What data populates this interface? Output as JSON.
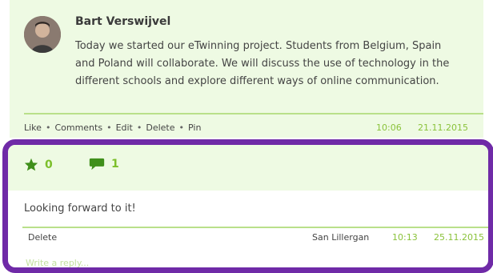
{
  "post": {
    "author": "Bart Verswijvel",
    "text": "Today we started our eTwinning project. Students from Belgium, Spain and Poland will collaborate. We will discuss the use of technology in the different schools and explore different ways of online communication.",
    "actions": [
      "Like",
      "Comments",
      "Edit",
      "Delete",
      "Pin"
    ],
    "time": "10:06",
    "date": "21.11.2015"
  },
  "stats": {
    "likes": "0",
    "comments": "1"
  },
  "comment": {
    "text": "Looking forward to it!",
    "delete_label": "Delete",
    "author": "San Lillergan",
    "time": "10:13",
    "date": "25.11.2015"
  },
  "reply": {
    "placeholder": "Write a reply..."
  },
  "colors": {
    "accent_green": "#8ac23a",
    "background_green": "#eefae3",
    "highlight_purple": "#6f2aa7"
  },
  "icons": [
    "avatar",
    "star-icon",
    "comment-bubble-icon"
  ]
}
